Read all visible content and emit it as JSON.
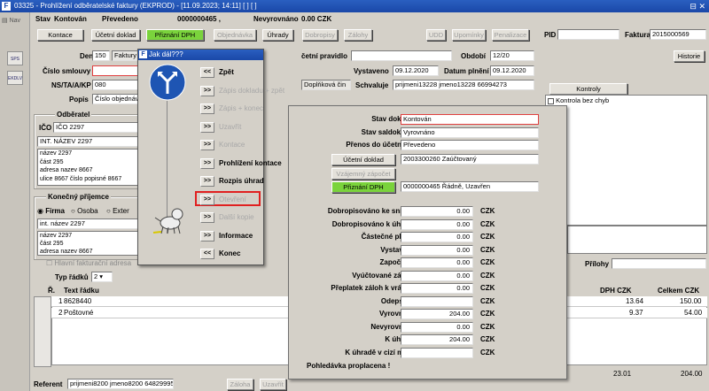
{
  "window": {
    "title": "03325 - Prohlížení odběratelské faktury (EKPROD) - [11.09.2023; 14:11]  [ ]  [ ]",
    "controls": "⊟ ✕"
  },
  "nav_label": "Nav",
  "sidebar_icons": [
    "SPS",
    "EKDLV"
  ],
  "status": {
    "stav_label": "Stav",
    "stav_value": "Kontován",
    "prevedeno_label": "Převedeno",
    "prevedeno_value": "0000000465 ,",
    "nevyrovnano_label": "Nevyrovnáno",
    "nevyrovnano_value": "0.00 CZK"
  },
  "toolbar": {
    "kontace": "Kontace",
    "ucetni_doklad": "Účetní doklad",
    "priznani_dph": "Přiznání DPH",
    "objednavka": "Objednávka",
    "uhrady": "Úhrady",
    "dobropisy": "Dobropisy",
    "zalohy": "Zálohy",
    "udd": "UDD",
    "upominky": "Upomínky",
    "penalizace": "Penalizace",
    "pid_label": "PID",
    "pid_value": "",
    "faktura_label": "Faktura",
    "faktura_value": "2015000569"
  },
  "form": {
    "denik_label": "Deník",
    "denik_value": "150",
    "denik_name": "Faktury",
    "ucetni_pravidlo_label": "četní pravidlo",
    "ucetni_pravidlo_value": "",
    "obdobi_label": "Období",
    "obdobi_value": "12/20",
    "historie": "Historie",
    "cislo_smlouvy_label": "Číslo smlouvy",
    "cislo_smlouvy_value": "",
    "vystaveno_label": "Vystaveno",
    "vystaveno_value": "09.12.2020",
    "datum_plneni_label": "Datum plnění",
    "datum_plneni_value": "09.12.2020",
    "ns_label": "NS/TA/A/KP",
    "ns_value": "080",
    "doplnkova_value": "Doplňková čin",
    "schvaluje_label": "Schvaluje",
    "schvaluje_value": "prijmeni13228 jmeno13228 66994273",
    "popis_label": "Popis",
    "popis_value": "Číslo objednáv",
    "kontroly": "Kontroly",
    "kontrola_bez_chyb": "Kontrola bez chyb"
  },
  "odberatel": {
    "title": "Odběratel",
    "ico_label": "IČO",
    "ico_value": "IČO 2297",
    "name": "INT. NÁZEV 2297",
    "addr": [
      "název 2297",
      "část 295",
      "adresa nazev 8667",
      "ulice 8667 číslo popisné 8667"
    ]
  },
  "konecny": {
    "title": "Konečný příjemce",
    "firma": "Firma",
    "osoba": "Osoba",
    "externi": "Exter",
    "name": "int. název 2297",
    "addr": [
      "název 2297",
      "část 295",
      "adresa nazev 8667"
    ],
    "hlavni": "Hlavní fakturační adresa"
  },
  "prilohy_label": "Přílohy",
  "lines": {
    "typ_label": "Typ řádků",
    "typ_value": "2",
    "col_r": "Ř.",
    "col_text": "Text řádku",
    "col_dph": "DPH CZK",
    "col_celkem": "Celkem CZK",
    "rows": [
      {
        "r": "1",
        "text": "8628440",
        "dph": "13.64",
        "celkem": "150.00"
      },
      {
        "r": "2",
        "text": "Poštovné",
        "dph": "9.37",
        "celkem": "54.00"
      }
    ],
    "sum_dph": "23.01",
    "sum_celkem": "204.00"
  },
  "footer": {
    "referent_label": "Referent",
    "referent_value": "prijmeni8200 jmeno8200 64829995",
    "zaloha": "Záloha",
    "uzavrit": "Uzavřít",
    "kontovat": "Kontovat"
  },
  "dialog": {
    "title": "Jak dál???",
    "items": [
      {
        "btn": "<<",
        "label": "Zpět",
        "enabled": true
      },
      {
        "btn": ">>",
        "label": "Zápis dokladu + zpět",
        "enabled": false
      },
      {
        "btn": ">>",
        "label": "Zápis + konec",
        "enabled": false
      },
      {
        "btn": ">>",
        "label": "Uzavřít",
        "enabled": false
      },
      {
        "btn": ">>",
        "label": "Kontace",
        "enabled": false
      },
      {
        "btn": ">>",
        "label": "Prohlížení kontace",
        "enabled": true
      },
      {
        "btn": ">>",
        "label": "Rozpis úhrad",
        "enabled": true
      },
      {
        "btn": ">>",
        "label": "Otevření",
        "enabled": false
      },
      {
        "btn": ">>",
        "label": "Další kopie",
        "enabled": false
      },
      {
        "btn": ">>",
        "label": "Informace",
        "enabled": true,
        "highlight": true
      },
      {
        "btn": "<<",
        "label": "Konec",
        "enabled": true
      }
    ]
  },
  "info": {
    "stav_dokladu_label": "Stav dokladu",
    "stav_dokladu_value": "Kontován",
    "stav_saldokonta_label": "Stav saldokonta",
    "stav_saldokonta_value": "Vyrovnáno",
    "prenos_label": "Přenos do účetnictví",
    "prenos_value": "Převedeno",
    "ucetni_doklad_btn": "Účetní doklad",
    "ucetni_doklad_value": "2003300260 Zaúčtovaný",
    "vzajemny_btn": "Vzájemný zápočet",
    "priznani_btn": "Přiznání DPH",
    "priznani_value": "0000000465 Řádně, Uzavřen",
    "rows": [
      {
        "label": "Dobropisováno ke snížení",
        "value": "0.00",
        "cur": "CZK"
      },
      {
        "label": "Dobropisováno k úhradě",
        "value": "0.00",
        "cur": "CZK"
      },
      {
        "label": "Částečné platby",
        "value": "0.00",
        "cur": "CZK"
      },
      {
        "label": "Vystaveno",
        "value": "0.00",
        "cur": "CZK"
      },
      {
        "label": "Započteno",
        "value": "0.00",
        "cur": "CZK"
      },
      {
        "label": "Vyúčtované zálohy",
        "value": "0.00",
        "cur": "CZK"
      },
      {
        "label": "Přeplatek záloh k vrácení",
        "value": "0.00",
        "cur": "CZK"
      },
      {
        "label": "Odepsáno",
        "value": "",
        "cur": "CZK"
      },
      {
        "label": "Vyrovnáno",
        "value": "204.00",
        "cur": "CZK"
      },
      {
        "label": "Nevyrovnáno",
        "value": "0.00",
        "cur": "CZK"
      },
      {
        "label": "K úhradě",
        "value": "204.00",
        "cur": "CZK"
      },
      {
        "label": "K úhradě v cizí měně",
        "value": "",
        "cur": "CZK"
      }
    ],
    "pohledavka": "Pohledávka proplacena !"
  }
}
